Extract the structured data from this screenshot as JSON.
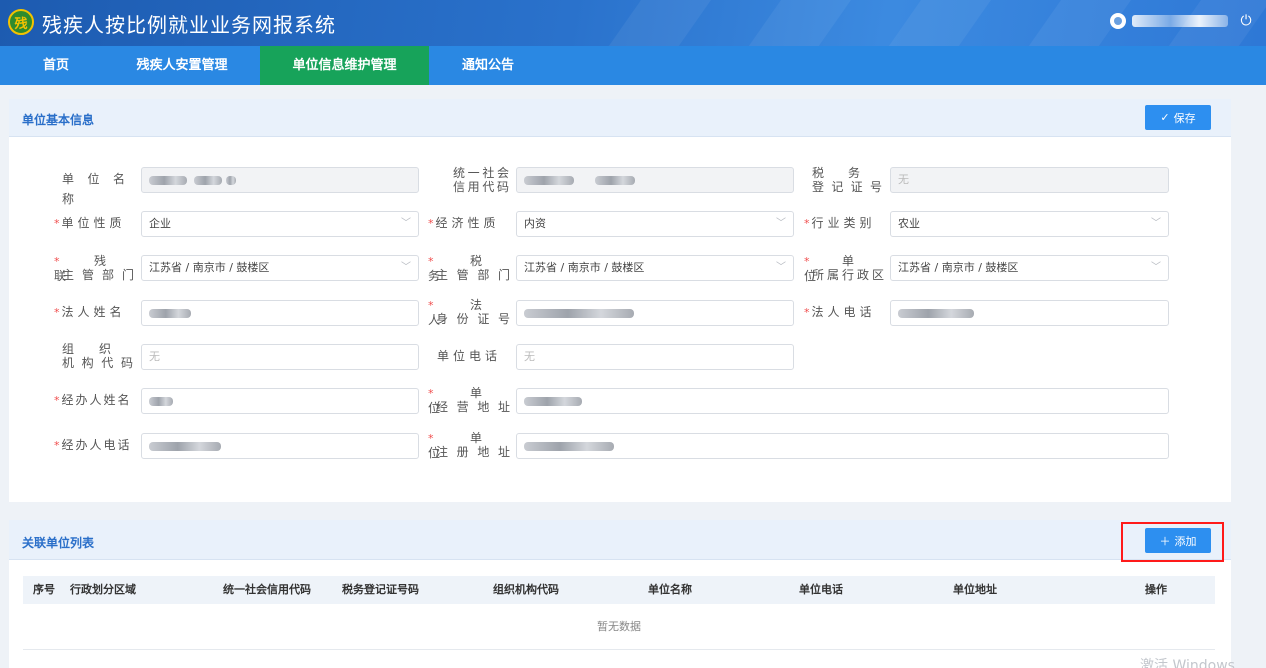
{
  "app": {
    "title": "残疾人按比例就业业务网报系统",
    "logo_char": "残"
  },
  "header": {
    "user_icon": "user-avatar-icon",
    "power_icon": "power-icon"
  },
  "nav": [
    {
      "label": "首页",
      "active": false
    },
    {
      "label": "残疾人安置管理",
      "active": false
    },
    {
      "label": "单位信息维护管理",
      "active": true
    },
    {
      "label": "通知公告",
      "active": false
    }
  ],
  "basic_info": {
    "title": "单位基本信息",
    "save_label": "保存",
    "save_icon": "check-icon",
    "fields": {
      "unit_name": {
        "label": "单位名称"
      },
      "credit_code": {
        "label_line1": "统一社会",
        "label_line2": "信用代码"
      },
      "tax_reg": {
        "label_line1": "税务",
        "label_line2": "登记证号",
        "value": "无"
      },
      "unit_nature": {
        "label": "单位性质",
        "value": "企业"
      },
      "economic_nature": {
        "label": "经济性质",
        "value": "内资"
      },
      "industry": {
        "label": "行业类别",
        "value": "农业"
      },
      "disabled_dept": {
        "label_line1": "残联",
        "label_line2": "主管部门",
        "value": "江苏省 / 南京市 / 鼓楼区"
      },
      "tax_dept": {
        "label_line1": "税务",
        "label_line2": "主管部门",
        "value": "江苏省 / 南京市 / 鼓楼区"
      },
      "admin_region": {
        "label_line1": "单位",
        "label_line2": "所属行政区",
        "value": "江苏省 / 南京市 / 鼓楼区"
      },
      "legal_name": {
        "label": "法人姓名"
      },
      "legal_id": {
        "label_line1": "法人",
        "label_line2": "身份证号"
      },
      "legal_phone": {
        "label": "法人电话"
      },
      "org_code": {
        "label_line1": "组织",
        "label_line2": "机构代码",
        "placeholder": "无"
      },
      "unit_phone": {
        "label": "单位电话",
        "placeholder": "无"
      },
      "agent_name": {
        "label": "经办人姓名"
      },
      "biz_address": {
        "label_line1": "单位",
        "label_line2": "经营地址"
      },
      "agent_phone": {
        "label": "经办人电话"
      },
      "reg_address": {
        "label_line1": "单位",
        "label_line2": "注册地址"
      }
    }
  },
  "related_units": {
    "title": "关联单位列表",
    "add_label": "添加",
    "columns": [
      "序号",
      "行政划分区域",
      "统一社会信用代码",
      "税务登记证号码",
      "组织机构代码",
      "单位名称",
      "单位电话",
      "单位地址",
      "操作"
    ],
    "empty_text": "暂无数据"
  },
  "watermark": "激活 Windows"
}
